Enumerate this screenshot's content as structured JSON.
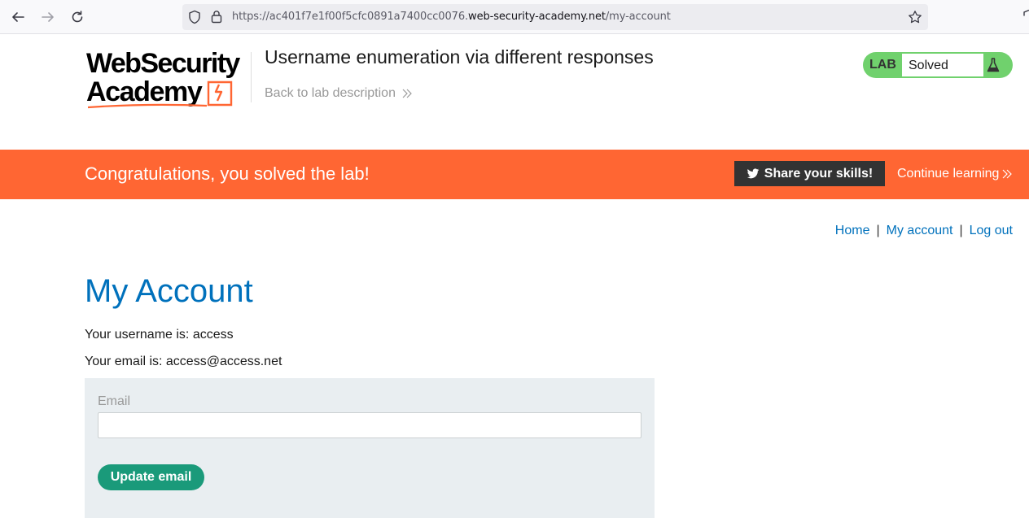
{
  "browser": {
    "url_prefix": "https://ac401f7e1f00f5cfc0891a7400cc0076.",
    "url_host": "web-security-academy.net",
    "url_path": "/my-account"
  },
  "header": {
    "logo_line1": "WebSecurity",
    "logo_line2": "Academy",
    "lab_title": "Username enumeration via different responses",
    "back_link": "Back to lab description",
    "lab_badge": "LAB",
    "lab_status": "Solved"
  },
  "banner": {
    "message": "Congratulations, you solved the lab!",
    "share_label": "Share your skills!",
    "continue_label": "Continue learning"
  },
  "nav": {
    "home": "Home",
    "my_account": "My account",
    "log_out": "Log out",
    "separator": "|"
  },
  "main": {
    "title": "My Account",
    "username_line": "Your username is: access",
    "email_line": "Your email is: access@access.net",
    "form": {
      "email_label": "Email",
      "email_value": "",
      "submit_label": "Update email"
    }
  },
  "colors": {
    "accent_orange": "#ff6633",
    "link_blue": "#0071bc",
    "solved_green": "#70d16d",
    "button_green": "#1a9a7a"
  }
}
